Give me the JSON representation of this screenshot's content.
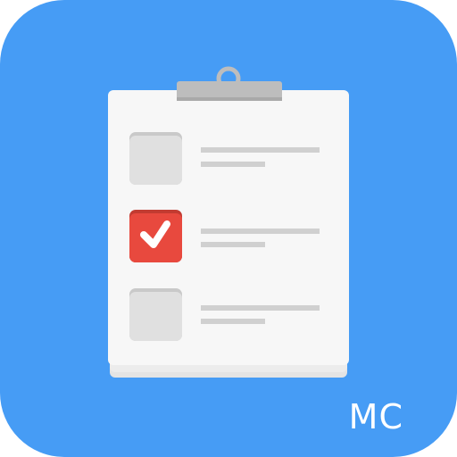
{
  "app_icon": {
    "background_color": "#469cf5",
    "corner_label": "MC",
    "checklist": [
      {
        "checked": false
      },
      {
        "checked": true
      },
      {
        "checked": false
      }
    ]
  },
  "colors": {
    "paper": "#f7f7f7",
    "clip": "#bdbdbd",
    "checkbox_unchecked": "#e0e0e0",
    "checkbox_checked": "#e8493e",
    "text_line": "#d0d0d0"
  }
}
